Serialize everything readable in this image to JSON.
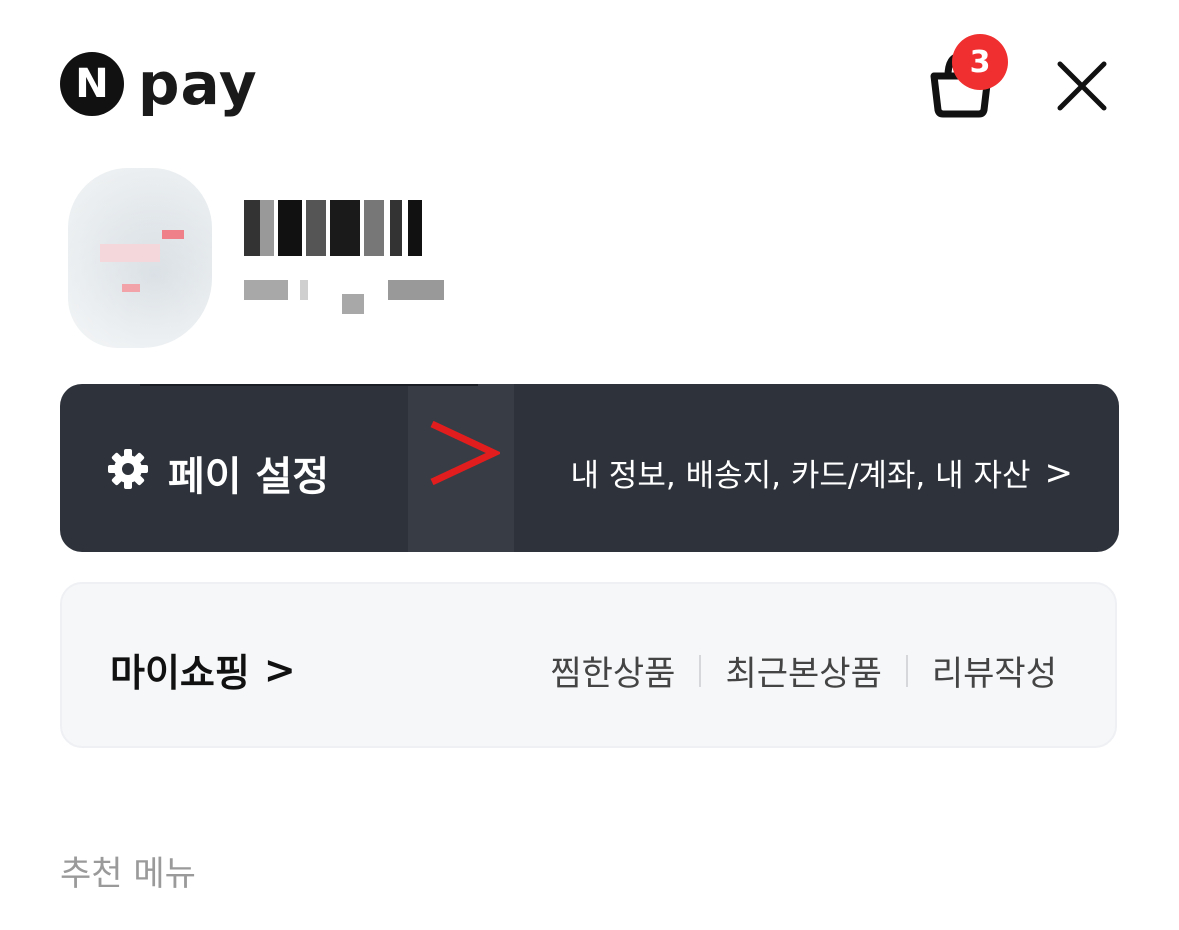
{
  "header": {
    "logo_n": "N",
    "logo_text": "pay",
    "cart_badge": "3",
    "icons": [
      "cart-icon",
      "close-icon"
    ]
  },
  "pay_settings": {
    "title": "페이 설정",
    "links": "내 정보, 배송지, 카드/계좌, 내 자산",
    "chevron": ">",
    "bg_color": "#2e333b"
  },
  "my_shopping": {
    "title": "마이쇼핑",
    "chevron": ">",
    "links": [
      "찜한상품",
      "최근본상품",
      "리뷰작성"
    ]
  },
  "section": {
    "recommend_title": "추천 메뉴"
  },
  "colors": {
    "badge": "#f03030",
    "annotation_arrow": "#e21d1d"
  }
}
